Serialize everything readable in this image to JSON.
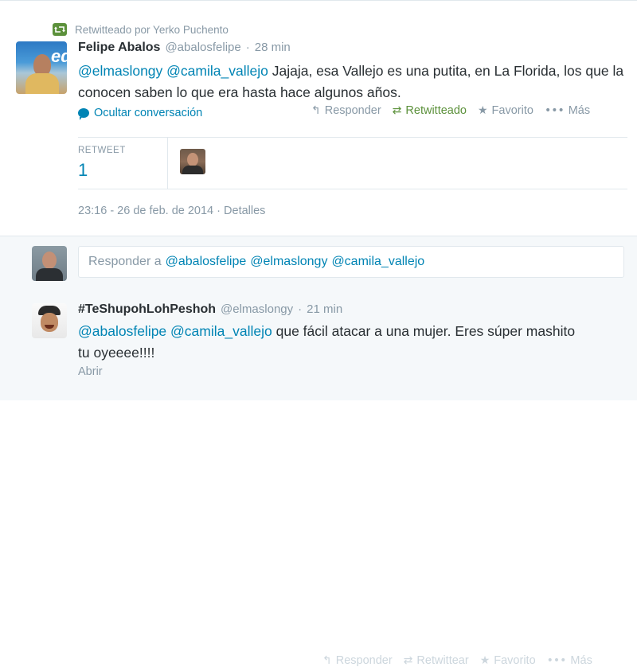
{
  "tweet1": {
    "retweet_context": "Retwitteado por Yerko Puchento",
    "fullname": "Felipe Abalos",
    "username": "@abalosfelipe",
    "separator": "·",
    "time": "28 min",
    "avatar_text": "edi",
    "mentions": [
      "@elmaslongy",
      "@camila_vallejo"
    ],
    "text": "Jajaja, esa Vallejo es una putita, en La Florida, los que la conocen saben lo que era hasta hace algunos años.",
    "hide_conversation": "Ocultar conversación",
    "actions": {
      "reply": "Responder",
      "retweet": "Retwitteado",
      "favorite": "Favorito",
      "more": "Más"
    },
    "stats": {
      "label": "RETWEET",
      "value": "1"
    },
    "timestamp": "23:16 - 26 de feb. de 2014",
    "details_link": "Detalles"
  },
  "reply_box": {
    "prefix": "Responder a",
    "mentions": [
      "@abalosfelipe",
      "@elmaslongy",
      "@camila_vallejo"
    ]
  },
  "tweet2": {
    "fullname": "#TeShupohLohPeshoh",
    "username": "@elmaslongy",
    "separator": "·",
    "time": "21 min",
    "mentions": [
      "@abalosfelipe",
      "@camila_vallejo"
    ],
    "text_line1": "que fácil atacar a una mujer. Eres súper mashito",
    "text_line2": "tu oyeeee!!!!",
    "open_link": "Abrir",
    "actions": {
      "reply": "Responder",
      "retweet": "Retwittear",
      "favorite": "Favorito",
      "more": "Más"
    }
  },
  "colors": {
    "link": "#0084b4",
    "muted": "#8899a6",
    "retweeted_green": "#5c913b",
    "panel_bg": "#f5f8fa",
    "border": "#e1e8ed"
  },
  "icons": {
    "retweet_badge": "retweet-icon",
    "conversation": "speech-bubble-icon",
    "reply": "reply-arrow-icon",
    "retweet": "retweet-icon",
    "favorite": "star-icon",
    "more": "ellipsis-icon"
  }
}
